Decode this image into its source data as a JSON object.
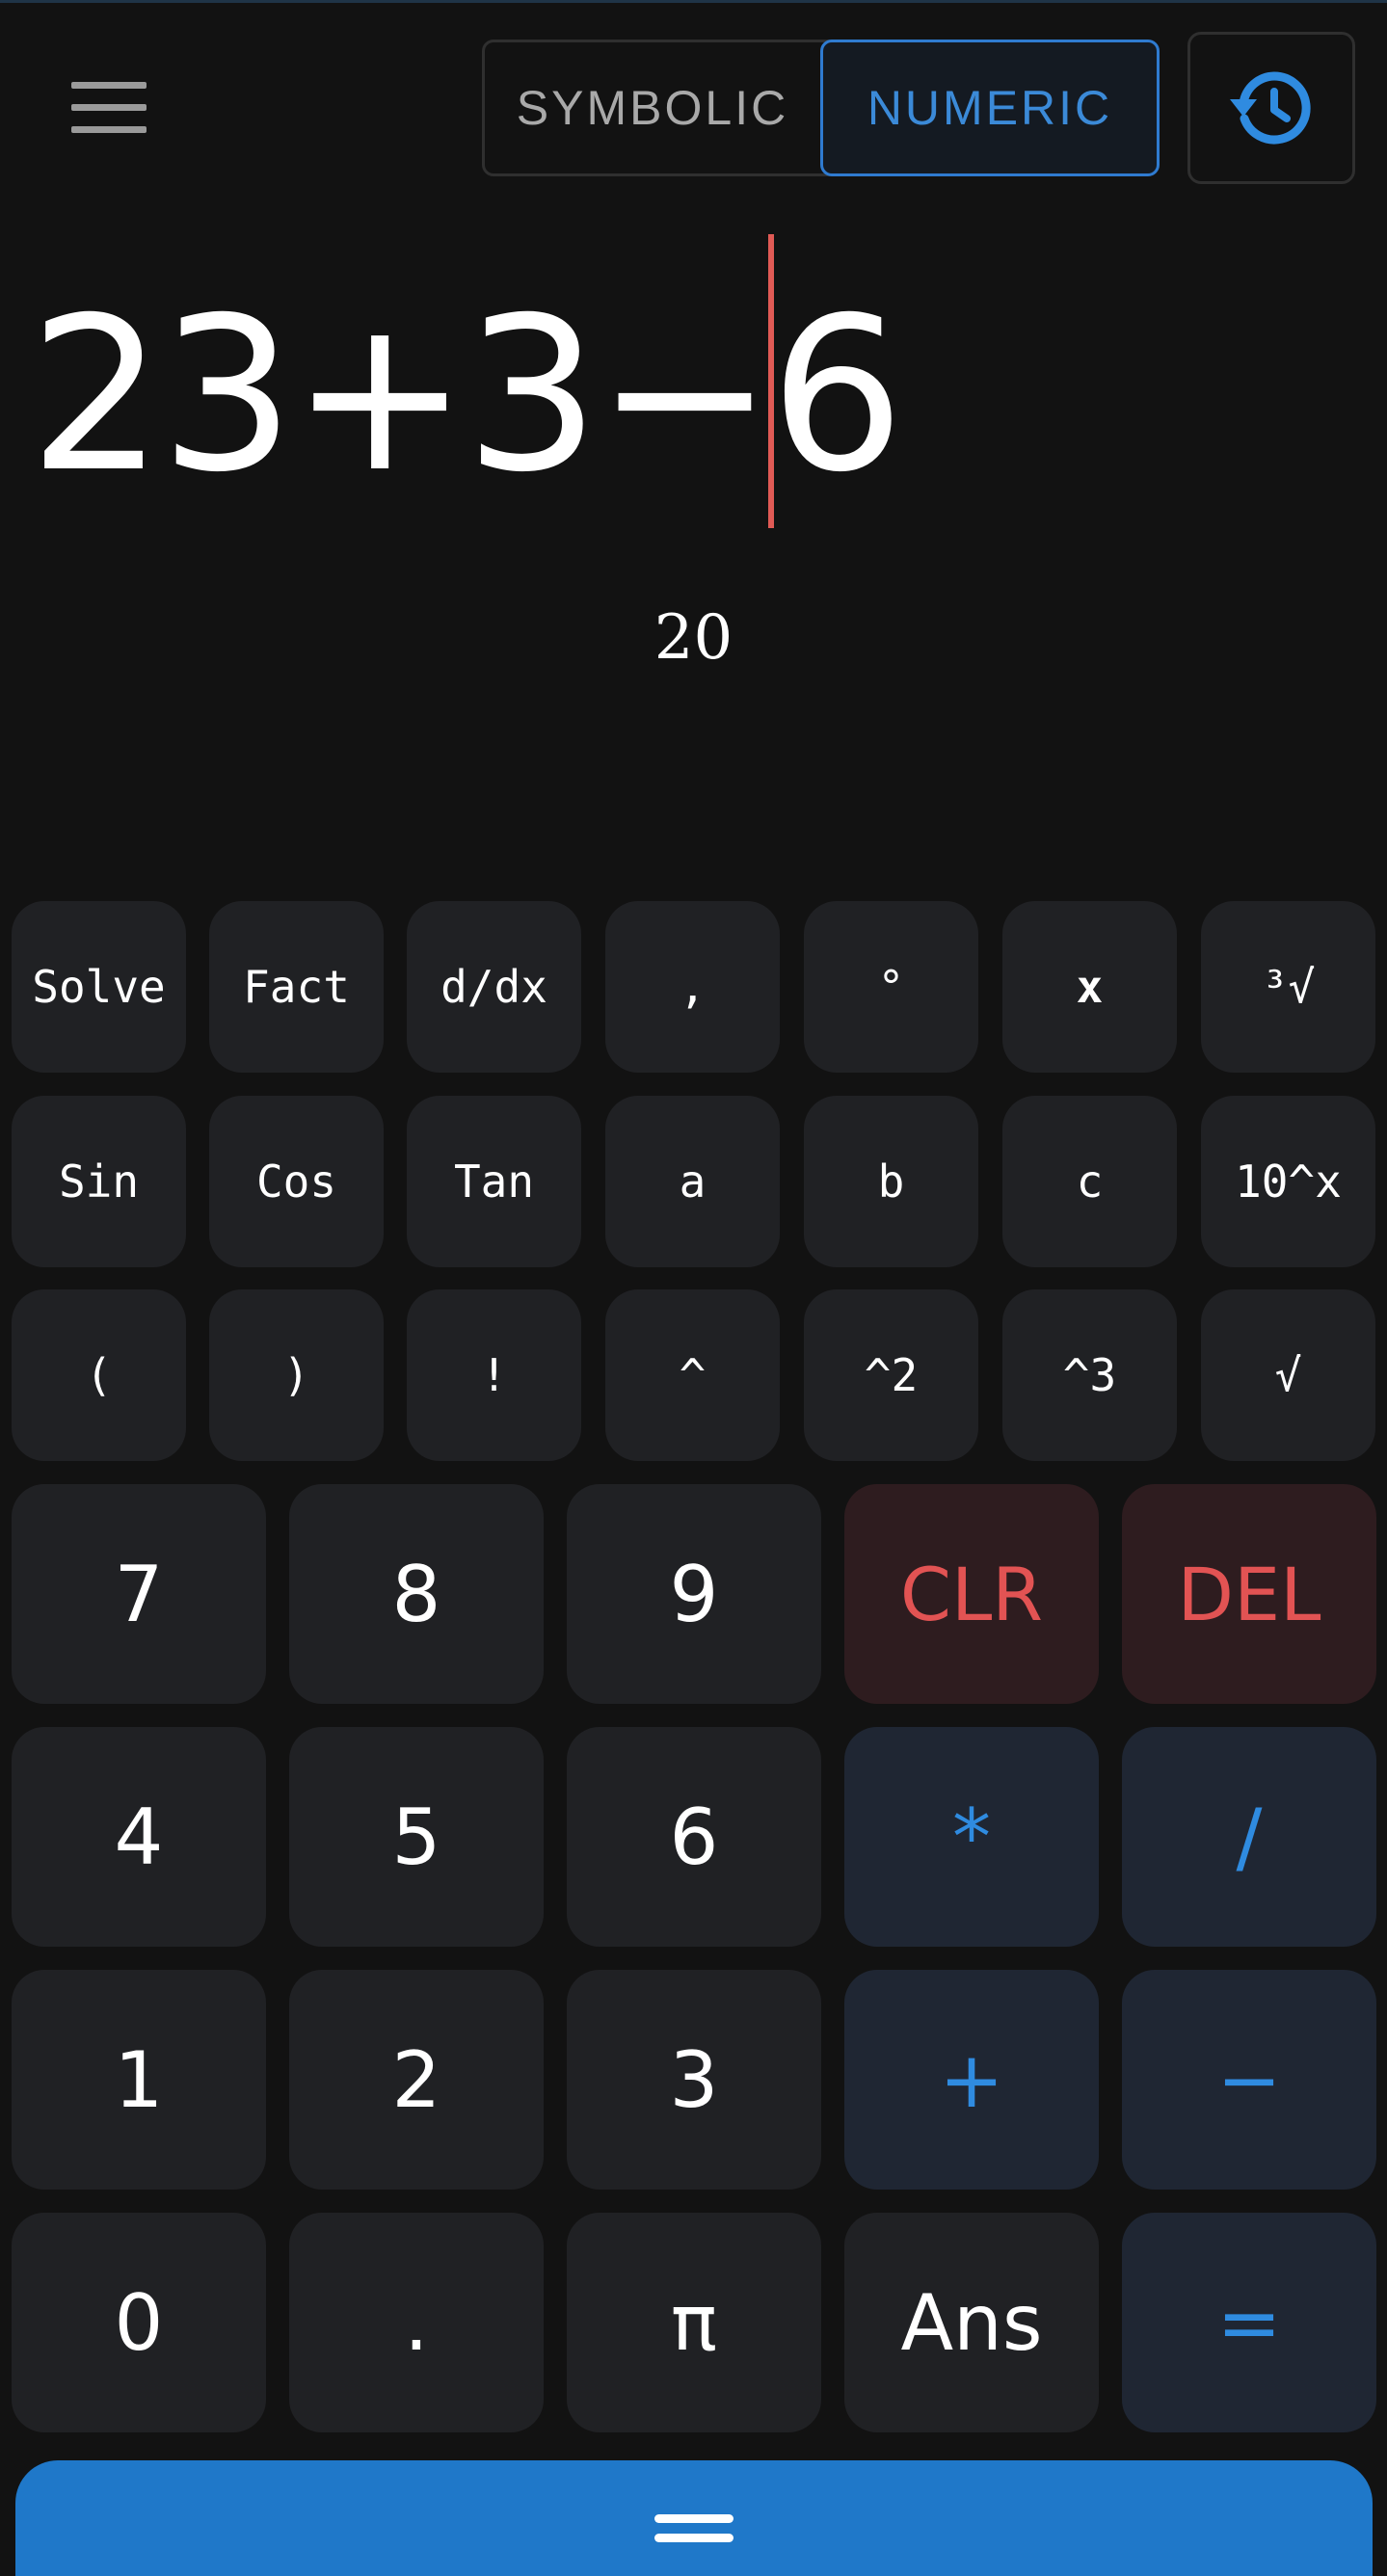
{
  "header": {
    "menu_icon": "hamburger-menu-icon",
    "modes": [
      "SYMBOLIC",
      "NUMERIC"
    ],
    "active_mode": "NUMERIC",
    "history_icon": "history-icon"
  },
  "display": {
    "expression": "23+3−6",
    "result": "20"
  },
  "keypad": {
    "function_rows": [
      [
        "Solve",
        "Fact",
        "d/dx",
        ",",
        "°",
        "x",
        "³√"
      ],
      [
        "Sin",
        "Cos",
        "Tan",
        "a",
        "b",
        "c",
        "10^x"
      ],
      [
        "(",
        ")",
        "!",
        "^",
        "^2",
        "^3",
        "√"
      ]
    ],
    "main_rows": [
      [
        "7",
        "8",
        "9",
        "CLR",
        "DEL"
      ],
      [
        "4",
        "5",
        "6",
        "*",
        "/"
      ],
      [
        "1",
        "2",
        "3",
        "+",
        "−"
      ],
      [
        "0",
        ".",
        "π",
        "Ans",
        "="
      ]
    ]
  },
  "bottom_bar": {
    "icon": "drag-handle-icon"
  },
  "colors": {
    "background": "#121212",
    "key": "#202124",
    "accent_blue": "#2f8be0",
    "danger_red": "#e25353",
    "cursor": "#e05a55",
    "bottom_bar": "#1f78c9"
  }
}
